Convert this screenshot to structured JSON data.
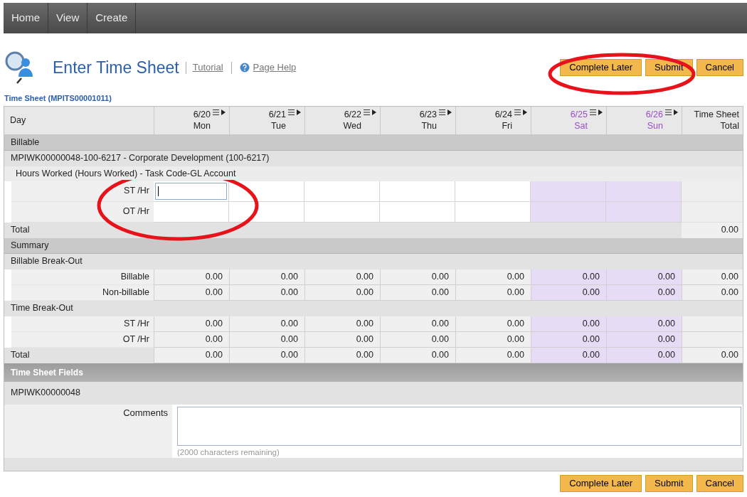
{
  "nav": [
    {
      "label": "Home"
    },
    {
      "label": "View"
    },
    {
      "label": "Create"
    }
  ],
  "header": {
    "title": "Enter Time Sheet",
    "links": [
      "Tutorial",
      "Page Help"
    ]
  },
  "top_actions": [
    "Complete Later",
    "Submit",
    "Cancel"
  ],
  "section_title": "Time Sheet (MPITS00001011)",
  "table": {
    "first_header": "Day",
    "total_header": "Time Sheet Total",
    "days": [
      {
        "date": "6/20",
        "weekday": "Mon",
        "weekend": false
      },
      {
        "date": "6/21",
        "weekday": "Tue",
        "weekend": false
      },
      {
        "date": "6/22",
        "weekday": "Wed",
        "weekend": false
      },
      {
        "date": "6/23",
        "weekday": "Thu",
        "weekend": false
      },
      {
        "date": "6/24",
        "weekday": "Fri",
        "weekend": false
      },
      {
        "date": "6/25",
        "weekday": "Sat",
        "weekend": true
      },
      {
        "date": "6/26",
        "weekday": "Sun",
        "weekend": true
      }
    ],
    "rows": [
      {
        "kind": "group",
        "label": "Billable"
      },
      {
        "kind": "project",
        "label": "MPIWK00000048-100-6217 - Corporate Development (100-6217)"
      },
      {
        "kind": "subheading",
        "label": "Hours Worked (Hours Worked) - Task Code-GL Account"
      },
      {
        "kind": "input",
        "label": "ST /Hr",
        "cells": [
          {
            "focused": true
          },
          {
            "focused": false
          },
          {
            "focused": false
          },
          {
            "focused": false
          },
          {
            "focused": false
          },
          {
            "focused": false
          },
          {
            "focused": false
          }
        ]
      },
      {
        "kind": "input",
        "label": "OT /Hr",
        "cells": [
          {
            "focused": false
          },
          {
            "focused": false
          },
          {
            "focused": false
          },
          {
            "focused": false
          },
          {
            "focused": false
          },
          {
            "focused": false
          },
          {
            "focused": false
          }
        ]
      },
      {
        "kind": "total",
        "label": "Total",
        "total": "0.00"
      },
      {
        "kind": "group",
        "label": "Summary"
      },
      {
        "kind": "subgroup",
        "label": "Billable Break-Out"
      },
      {
        "kind": "values",
        "label": "Billable",
        "values": [
          "0.00",
          "0.00",
          "0.00",
          "0.00",
          "0.00",
          "0.00",
          "0.00"
        ],
        "total": "0.00"
      },
      {
        "kind": "values",
        "label": "Non-billable",
        "values": [
          "0.00",
          "0.00",
          "0.00",
          "0.00",
          "0.00",
          "0.00",
          "0.00"
        ],
        "total": "0.00"
      },
      {
        "kind": "subgroup",
        "label": "Time Break-Out"
      },
      {
        "kind": "values",
        "label": "ST /Hr",
        "values": [
          "0.00",
          "0.00",
          "0.00",
          "0.00",
          "0.00",
          "0.00",
          "0.00"
        ]
      },
      {
        "kind": "values",
        "label": "OT /Hr",
        "values": [
          "0.00",
          "0.00",
          "0.00",
          "0.00",
          "0.00",
          "0.00",
          "0.00"
        ]
      },
      {
        "kind": "grand_total",
        "label": "Total",
        "values": [
          "0.00",
          "0.00",
          "0.00",
          "0.00",
          "0.00",
          "0.00",
          "0.00"
        ],
        "total": "0.00"
      }
    ]
  },
  "fields": {
    "title": "Time Sheet Fields",
    "id": "MPIWK00000048",
    "comments_label": "Comments",
    "remaining": "(2000 characters remaining)"
  },
  "bottom_actions": [
    "Complete Later",
    "Submit",
    "Cancel"
  ]
}
